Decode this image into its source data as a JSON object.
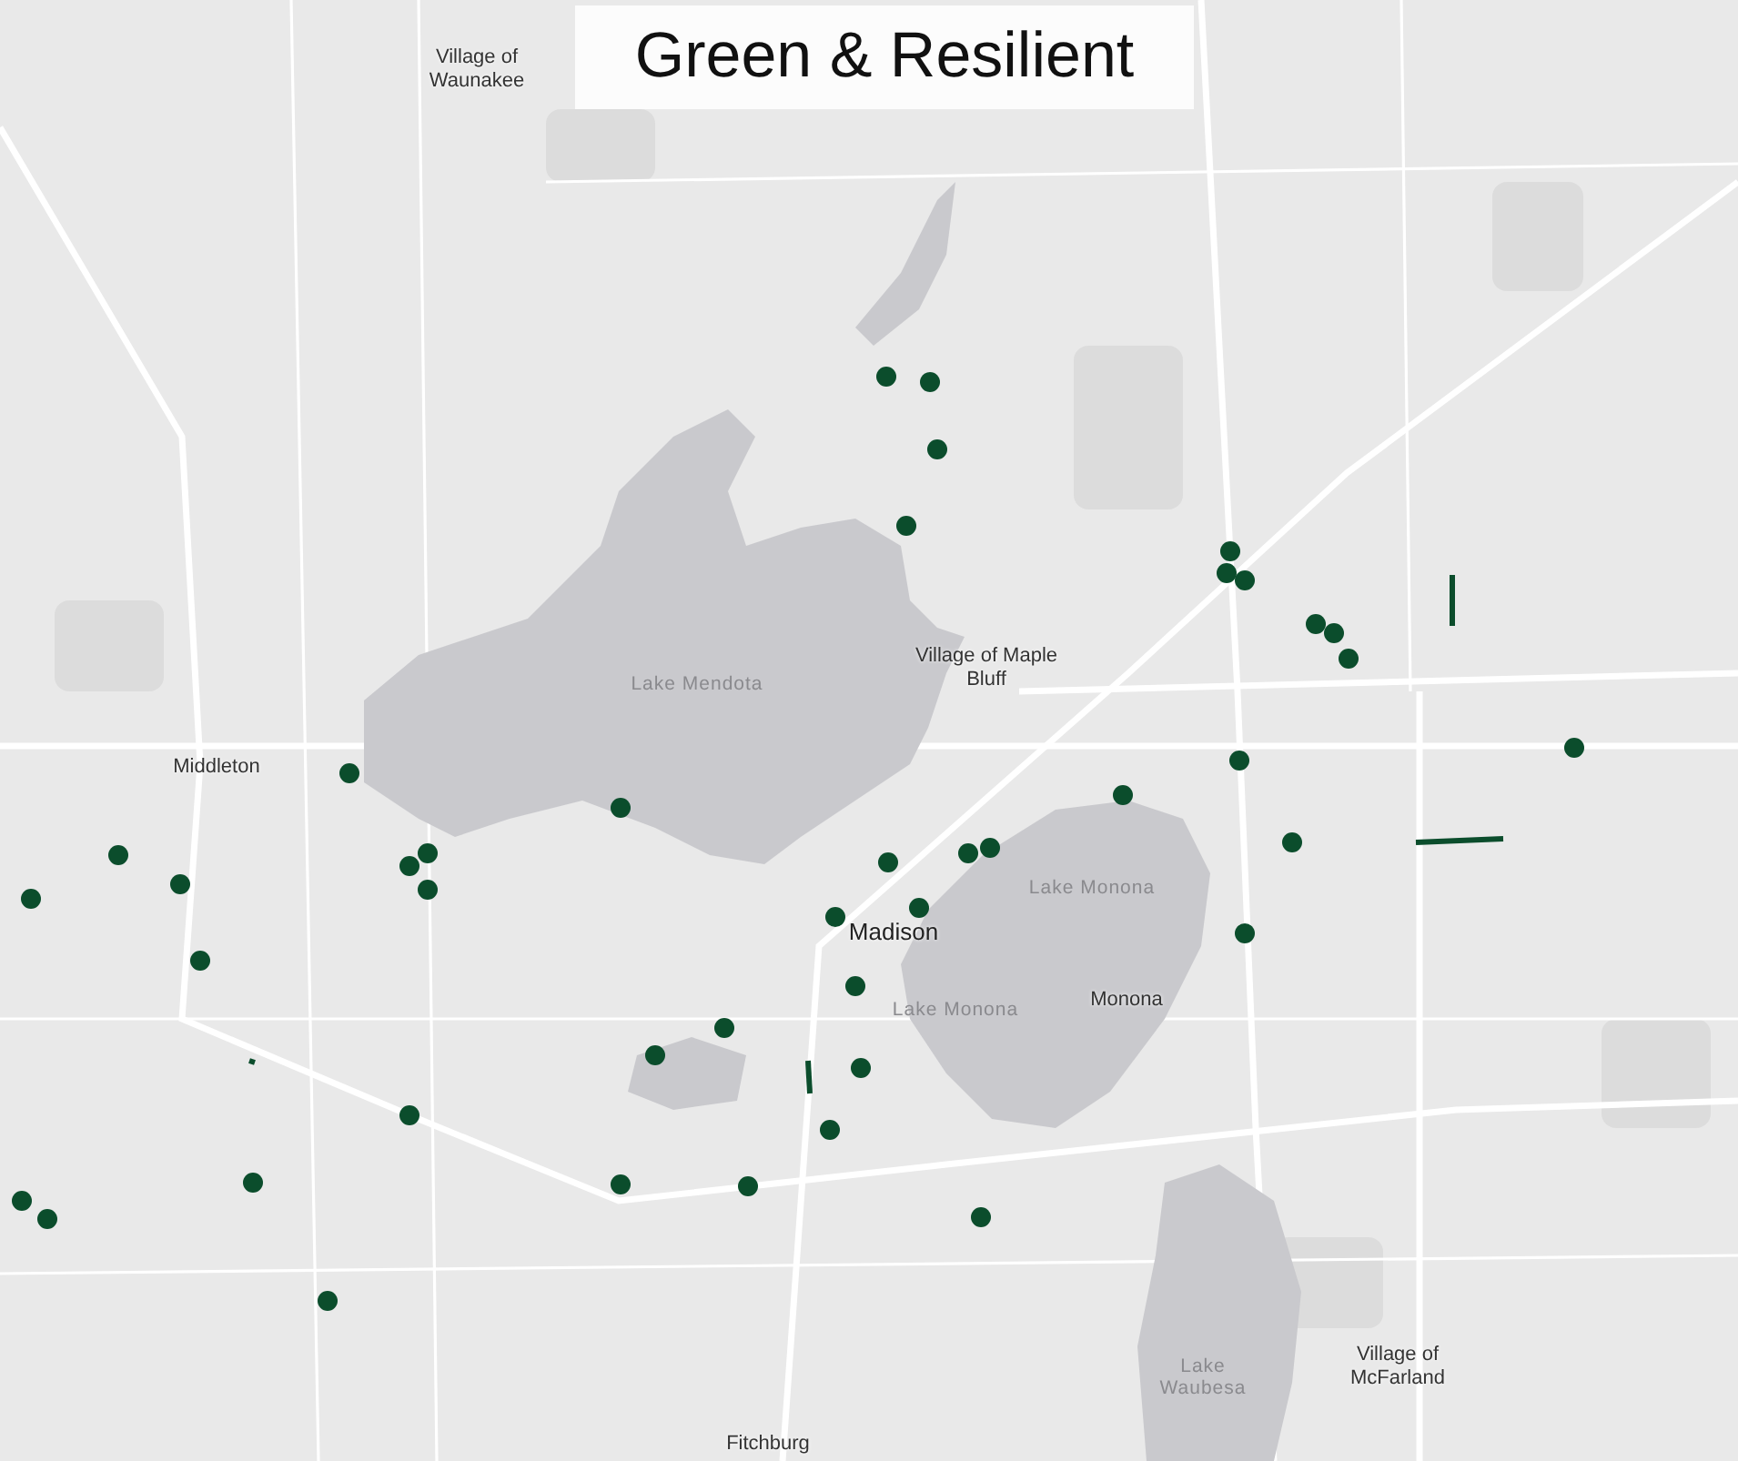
{
  "title": "Green & Resilient",
  "map_labels": [
    {
      "text": "Village of Waunakee",
      "kind": "place"
    },
    {
      "text": "Lake Mendota",
      "kind": "water"
    },
    {
      "text": "Village of Maple Bluff",
      "kind": "place"
    },
    {
      "text": "Middleton",
      "kind": "place"
    },
    {
      "text": "Madison",
      "kind": "city"
    },
    {
      "text": "Lake Monona",
      "kind": "water"
    },
    {
      "text": "Lake Monona",
      "kind": "water"
    },
    {
      "text": "Monona",
      "kind": "place"
    },
    {
      "text": "Lake Waubesa",
      "kind": "water"
    },
    {
      "text": "Village of McFarland",
      "kind": "place"
    },
    {
      "text": "Fitchburg",
      "kind": "place"
    }
  ]
}
